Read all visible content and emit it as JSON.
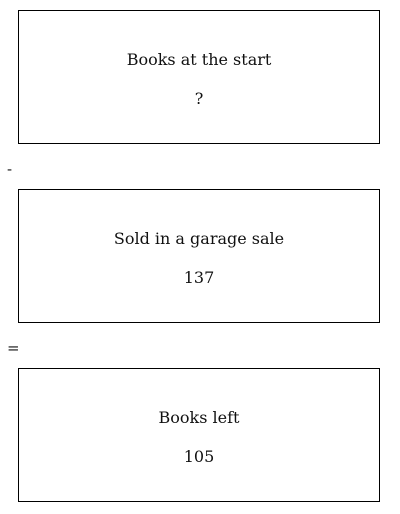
{
  "boxes": [
    {
      "title": "Books at the start",
      "value": "?"
    },
    {
      "title": "Sold in a garage sale",
      "value": "137"
    },
    {
      "title": "Books left",
      "value": "105"
    }
  ],
  "operators": {
    "first": "-",
    "second": "="
  }
}
